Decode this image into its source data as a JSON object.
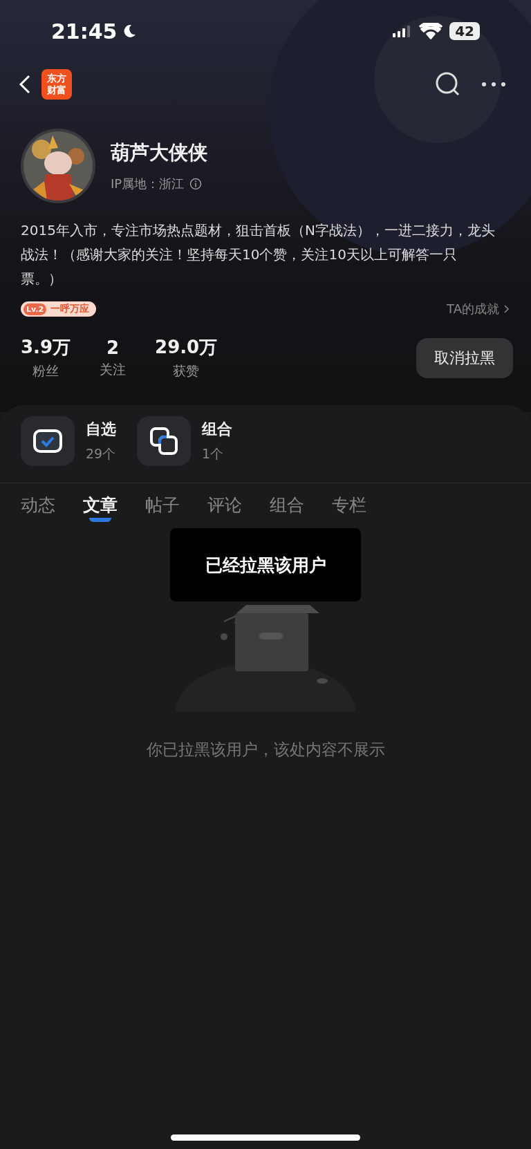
{
  "status_bar": {
    "time": "21:45",
    "battery": "42"
  },
  "nav": {
    "logo": [
      "东方",
      "财富"
    ]
  },
  "profile": {
    "name": "葫芦大侠侠",
    "ip_location": "IP属地：浙江",
    "bio": "2015年入市，专注市场热点题材，狙击首板（N字战法），一进二接力，龙头战法！（感谢大家的关注！坚持每天10个赞，关注10天以上可解答一只票。）",
    "badge": {
      "level": "Lv.2",
      "title": "一呼万应"
    },
    "achievements_link": "TA的成就",
    "stats": [
      {
        "value": "3.9万",
        "label": "粉丝"
      },
      {
        "value": "2",
        "label": "关注"
      },
      {
        "value": "29.0万",
        "label": "获赞"
      }
    ],
    "unblock_button": "取消拉黑"
  },
  "shortcuts": [
    {
      "kind": "watchlist",
      "title": "自选",
      "count": "29个"
    },
    {
      "kind": "portfolio",
      "title": "组合",
      "count": "1个"
    }
  ],
  "tabs": [
    {
      "label": "动态",
      "selected": false
    },
    {
      "label": "文章",
      "selected": true
    },
    {
      "label": "帖子",
      "selected": false
    },
    {
      "label": "评论",
      "selected": false
    },
    {
      "label": "组合",
      "selected": false
    },
    {
      "label": "专栏",
      "selected": false
    }
  ],
  "toast": "已经拉黑该用户",
  "empty_message": "你已拉黑该用户，该处内容不展示"
}
